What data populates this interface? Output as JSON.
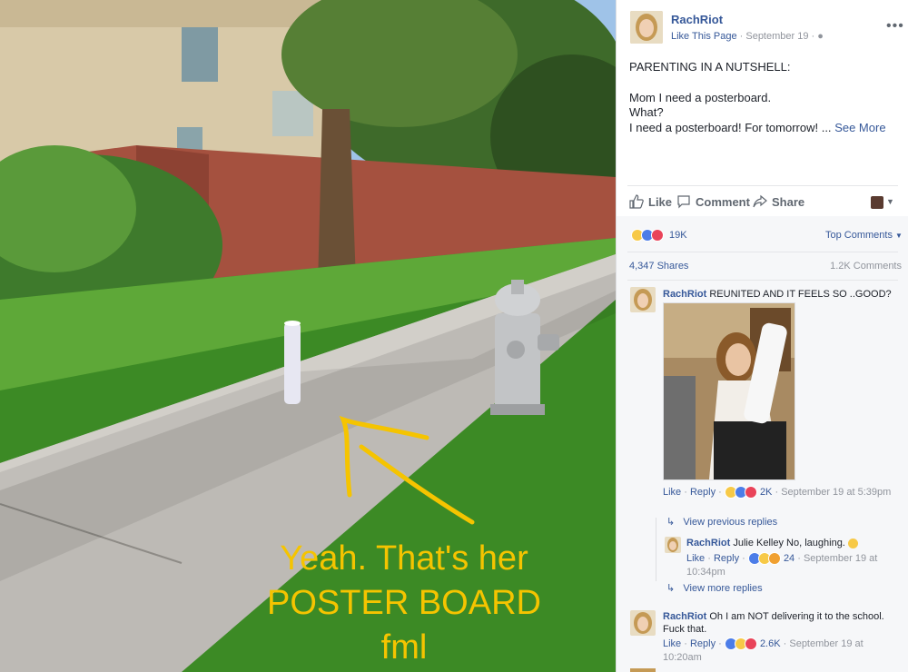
{
  "photo": {
    "caption_lines": [
      "Yeah. That's her",
      "POSTER BOARD",
      "fml"
    ]
  },
  "post": {
    "page_name": "RachRiot",
    "like_page": "Like This Page",
    "date": "September 19",
    "lines": [
      "PARENTING IN A NUTSHELL:",
      "",
      "Mom I need a posterboard.",
      "What?",
      "I need a posterboard! For tomorrow! ..."
    ],
    "see_more": "See More"
  },
  "actions": {
    "like": "Like",
    "comment": "Comment",
    "share": "Share"
  },
  "stats": {
    "reactions_count": "19K",
    "sort_label": "Top Comments",
    "shares": "4,347 Shares",
    "comments": "1.2K Comments"
  },
  "comments": [
    {
      "author": "RachRiot",
      "text": "REUNITED AND IT FEELS SO ..GOOD?",
      "like": "Like",
      "reply": "Reply",
      "reactions": "2K",
      "time": "September 19 at 5:39pm",
      "view_previous": "View previous replies",
      "reply_item": {
        "author": "RachRiot",
        "text": "Julie Kelley No, laughing.",
        "like": "Like",
        "reply": "Reply",
        "reactions": "24",
        "time": "September 19 at 10:34pm"
      },
      "view_more": "View more replies"
    },
    {
      "author": "RachRiot",
      "text": "Oh I am NOT delivering it to the school. Fuck that.",
      "like": "Like",
      "reply": "Reply",
      "reactions": "2.6K",
      "time": "September 19 at 10:20am"
    }
  ],
  "colors": {
    "link": "#365899",
    "caption": "#f5c400",
    "meta": "#90949c"
  }
}
